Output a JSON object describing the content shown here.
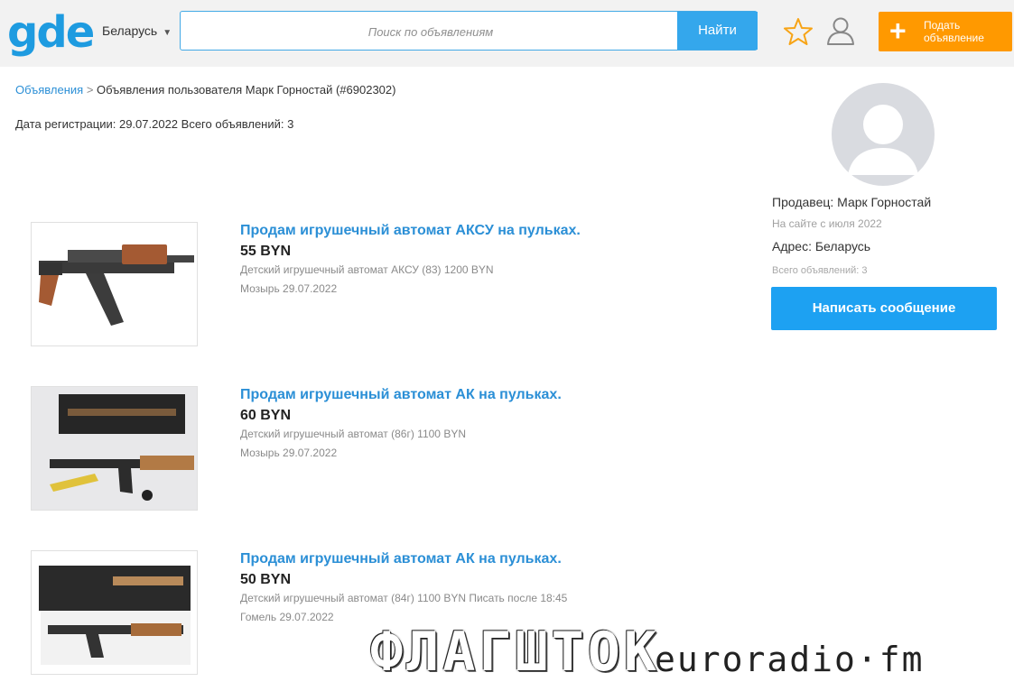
{
  "header": {
    "logo": "gde",
    "region": "Беларусь",
    "search_placeholder": "Поиск по объявлениям",
    "search_button": "Найти",
    "post_button_line1": "Подать",
    "post_button_line2": "объявление"
  },
  "breadcrumb": {
    "root": "Объявления",
    "separator": ">",
    "current": "Объявления пользователя Марк Горностай (#6902302)"
  },
  "reg_info": "Дата регистрации: 29.07.2022 Всего объявлений: 3",
  "listings": [
    {
      "title": "Продам игрушечный автомат АКСУ на пульках.",
      "price": "55 BYN",
      "description": "Детский игрушечный автомат АКСУ (83) 1200 BYN",
      "location_date": "Мозырь 29.07.2022"
    },
    {
      "title": "Продам игрушечный автомат АК на пульках.",
      "price": "60 BYN",
      "description": "Детский игрушечный автомат (86г) 1100 BYN",
      "location_date": "Мозырь 29.07.2022"
    },
    {
      "title": "Продам игрушечный автомат АК на пульках.",
      "price": "50 BYN",
      "description": "Детский игрушечный автомат (84г) 1100 BYN Писать после 18:45",
      "location_date": "Гомель 29.07.2022"
    }
  ],
  "seller": {
    "name": "Продавец: Марк Горностай",
    "since": "На сайте с июля 2022",
    "address": "Адрес: Беларусь",
    "count": "Всего объявлений: 3",
    "message_button": "Написать сообщение"
  },
  "watermark": {
    "left": "ФЛАГШТОК",
    "right": "euroradio·fm"
  },
  "colors": {
    "brand_blue": "#1e9be0",
    "link_blue": "#2b8fd6",
    "search_button": "#34a7ec",
    "post_button": "#ff9900",
    "message_button": "#1da1f2",
    "header_bg": "#f2f2f2"
  },
  "icons": {
    "favorites": "star-icon",
    "account": "user-icon",
    "post": "plus-icon",
    "region": "chevron-down-icon",
    "seller_avatar": "avatar-placeholder"
  }
}
